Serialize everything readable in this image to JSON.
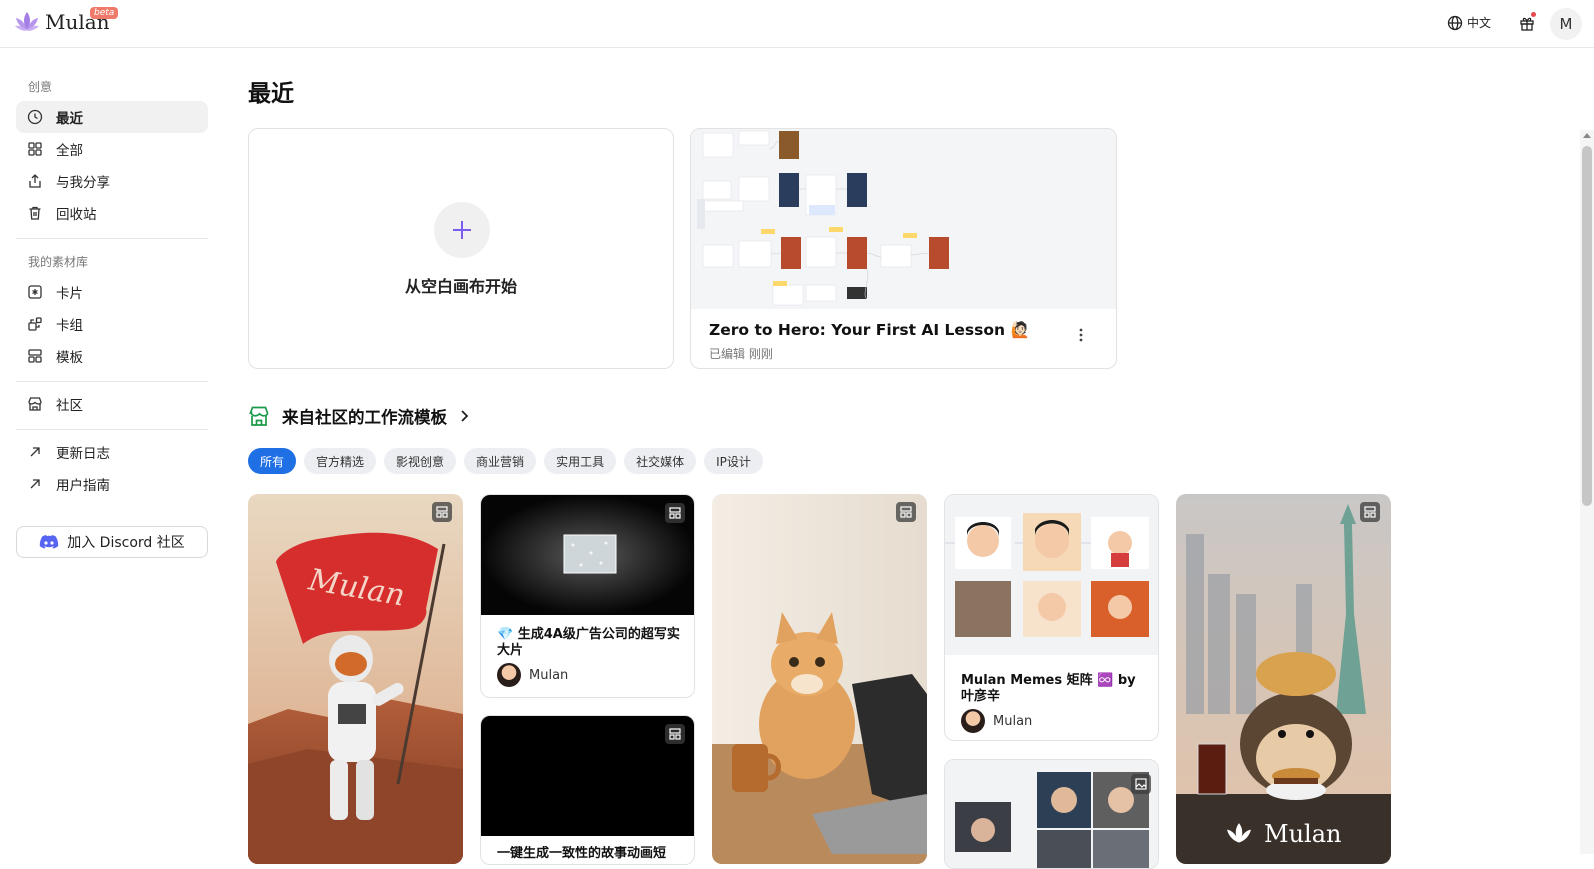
{
  "brand": {
    "name": "Mulan",
    "badge": "beta"
  },
  "topbar": {
    "language": "中文",
    "avatar_initial": "M"
  },
  "sidebar": {
    "section_creative": "创意",
    "nav_recent": "最近",
    "nav_all": "全部",
    "nav_shared": "与我分享",
    "nav_trash": "回收站",
    "section_library": "我的素材库",
    "nav_cards": "卡片",
    "nav_card_groups": "卡组",
    "nav_templates": "模板",
    "nav_community": "社区",
    "nav_changelog": "更新日志",
    "nav_guide": "用户指南",
    "discord_button": "加入 Discord 社区"
  },
  "main": {
    "title": "最近",
    "blank_canvas_label": "从空白画布开始",
    "project": {
      "title": "Zero to Hero: Your First AI Lesson 🙋🏻",
      "edited": "已编辑 刚刚"
    },
    "community_heading": "来自社区的工作流模板",
    "filters": [
      "所有",
      "官方精选",
      "影视创意",
      "商业营销",
      "实用工具",
      "社交媒体",
      "IP设计"
    ],
    "templates": {
      "ad_title": "💎 生成4A级广告公司的超写实大片",
      "ad_author": "Mulan",
      "story_title": "一键生成一致性的故事动画短",
      "memes_title": "Mulan Memes 矩阵 ♾️ by 叶彦辛",
      "memes_author": "Mulan",
      "mulan_flag_text": "Mulan",
      "hedgehog_watermark": "Mulan"
    }
  },
  "colors": {
    "accent": "#1f6fe5",
    "community_icon": "#1a9a4a",
    "plus": "#7a5cf0"
  }
}
